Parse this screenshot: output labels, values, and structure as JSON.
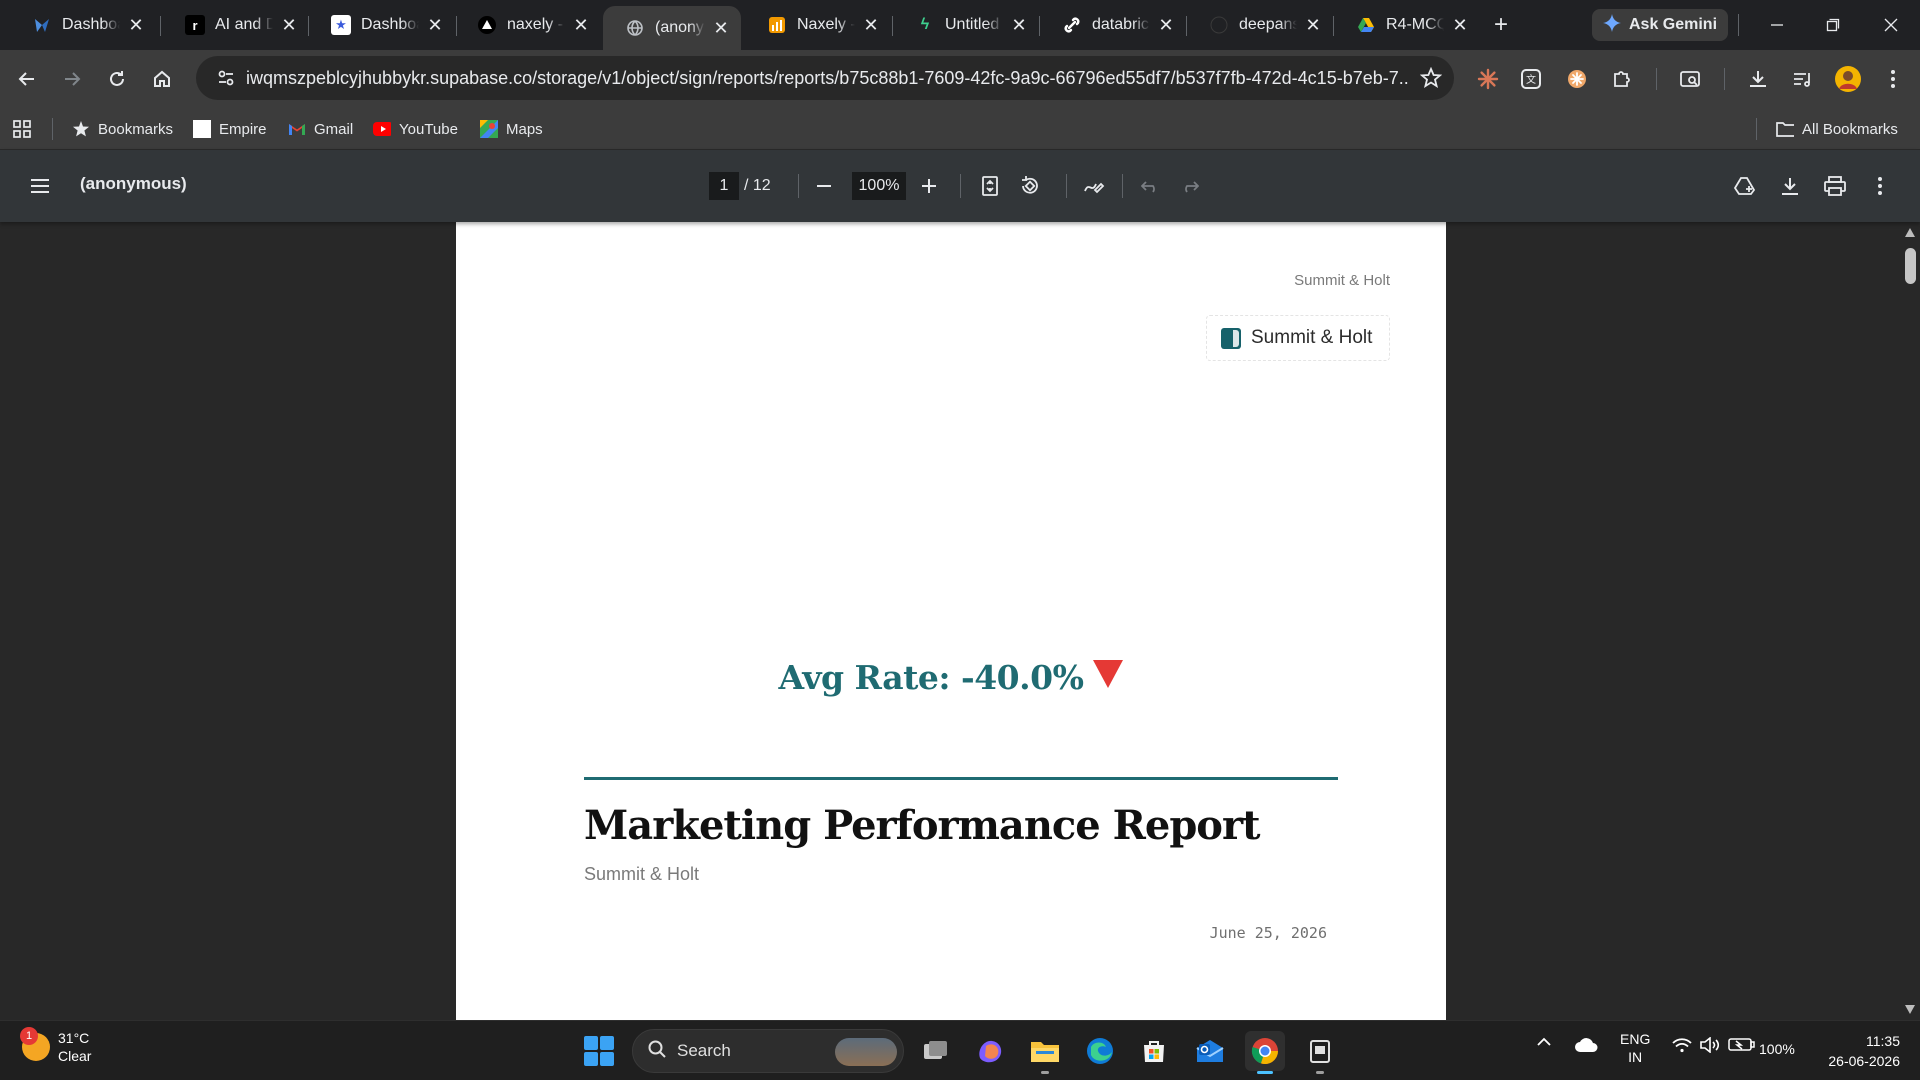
{
  "tabs": [
    {
      "title": "Dashboard",
      "icon": "tableau-icon",
      "active": false
    },
    {
      "title": "AI and Data",
      "icon": "r-icon",
      "active": false
    },
    {
      "title": "Dashboard",
      "icon": "star-badge-icon",
      "active": false
    },
    {
      "title": "naxely - Gamma",
      "icon": "triangle-logo-icon",
      "active": false
    },
    {
      "title": "(anonymous)",
      "icon": "globe-icon",
      "active": true
    },
    {
      "title": "Naxely - Looker",
      "icon": "bar-chart-icon",
      "active": false
    },
    {
      "title": "Untitled",
      "icon": "bolt-icon",
      "active": false
    },
    {
      "title": "databricks",
      "icon": "link-icon",
      "active": false
    },
    {
      "title": "deepanshu",
      "icon": "github-icon",
      "active": false
    },
    {
      "title": "R4-MCQ",
      "icon": "google-drive-icon",
      "active": false
    }
  ],
  "ask_gemini": "Ask Gemini",
  "address": {
    "url": "iwqmszpeblcyjhubbykr.supabase.co/storage/v1/object/sign/reports/reports/b75c88b1-7609-42fc-9a9c-66796ed55df7/b537f7fb-472d-4c15-b7eb-7..."
  },
  "bookmarks": {
    "items": [
      {
        "label": "Bookmarks",
        "icon": "star-icon"
      },
      {
        "label": "Empire",
        "icon": "blank-page-icon"
      },
      {
        "label": "Gmail",
        "icon": "gmail-icon"
      },
      {
        "label": "YouTube",
        "icon": "youtube-icon"
      },
      {
        "label": "Maps",
        "icon": "maps-icon"
      }
    ],
    "all_bookmarks": "All Bookmarks"
  },
  "pdf_viewer": {
    "doc_title": "(anonymous)",
    "page_current": "1",
    "page_total": "/ 12",
    "zoom": "100%"
  },
  "document": {
    "header_brand": "Summit & Holt",
    "logo_text": "Summit & Holt",
    "kpi_label": "Avg Rate: -40.0%",
    "kpi_trend": "down",
    "title": "Marketing Performance Report",
    "subtitle": "Summit & Holt",
    "date": "June 25, 2026"
  },
  "colors": {
    "accent_teal": "#1f6b72",
    "trend_down_red": "#e53935",
    "browser_dark": "#202124",
    "pdf_toolbar": "#323639"
  },
  "taskbar": {
    "weather_temp": "31°C",
    "weather_desc": "Clear",
    "weather_badge": "1",
    "search_placeholder": "Search",
    "lang_top": "ENG",
    "lang_bottom": "IN",
    "battery": "100%",
    "time": "11:35",
    "date": "26-06-2026"
  }
}
